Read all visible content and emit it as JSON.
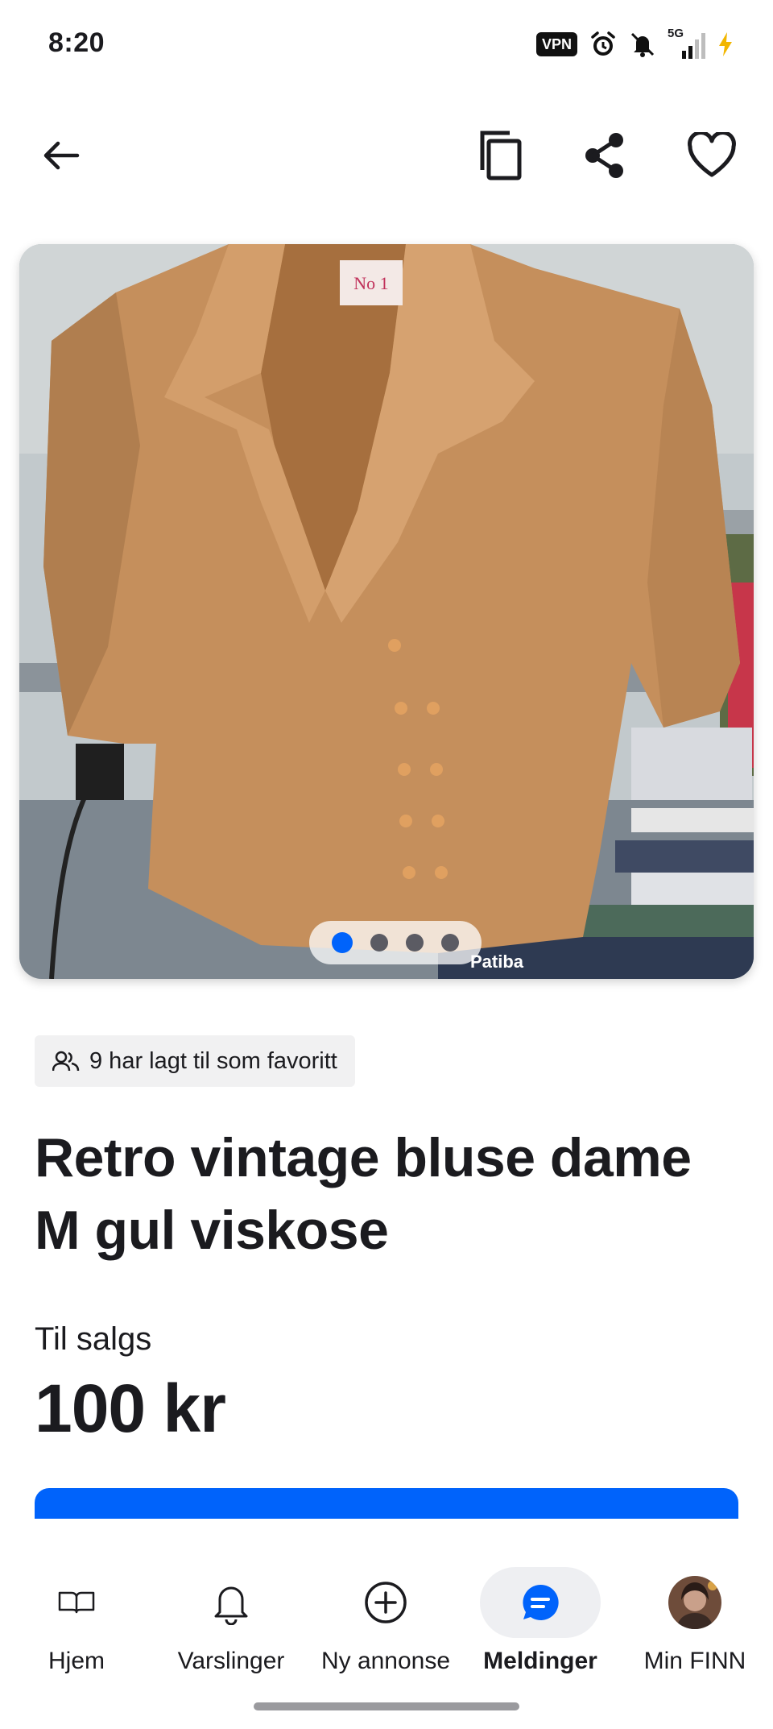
{
  "status_bar": {
    "time": "8:20",
    "vpn_label": "VPN",
    "network_label": "5G",
    "icons": [
      "vpn-icon",
      "alarm-icon",
      "bell-off-icon",
      "signal-5g-icon",
      "battery-charging-icon"
    ]
  },
  "top_nav": {
    "icons": [
      "back-arrow-icon",
      "copy-icon",
      "share-icon",
      "heart-icon"
    ]
  },
  "gallery": {
    "image_count": 4,
    "active_index": 0,
    "label_text": "No 1",
    "book_text": "Patiba"
  },
  "listing": {
    "favorites_text": "9 har lagt til som favoritt",
    "title": "Retro vintage bluse dame M gul viskose",
    "sale_label": "Til salgs",
    "price": "100 kr"
  },
  "bottom_nav": {
    "tabs": [
      {
        "label": "Hjem",
        "icon": "book-open-icon"
      },
      {
        "label": "Varslinger",
        "icon": "bell-icon"
      },
      {
        "label": "Ny annonse",
        "icon": "plus-circle-icon"
      },
      {
        "label": "Meldinger",
        "icon": "chat-bubble-icon",
        "active": true
      },
      {
        "label": "Min FINN",
        "icon": "avatar"
      }
    ]
  },
  "colors": {
    "accent": "#0063fb",
    "text": "#1b1b1f",
    "badge_bg": "#f1f1f2",
    "active_tab_bg": "#eeeff2"
  }
}
